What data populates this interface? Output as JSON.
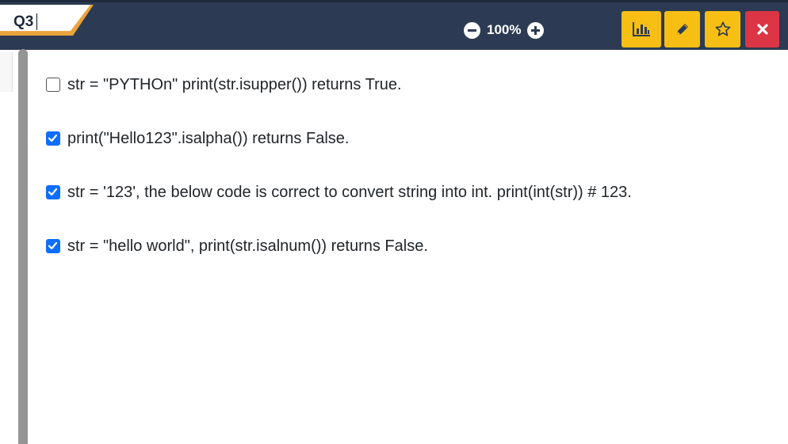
{
  "header": {
    "question_label": "Q3",
    "zoom_level": "100%"
  },
  "toolbar": {
    "report_icon": "bar-chart-icon",
    "edit_icon": "pencil-icon",
    "bookmark_icon": "star-icon",
    "close_icon": "close-icon",
    "accent_yellow": "#f7bf14",
    "accent_red": "#dc3545",
    "header_bg": "#2c3b53"
  },
  "options": [
    {
      "text": "str = \"PYTHOn\" print(str.isupper()) returns True.",
      "checked": false
    },
    {
      "text": "print(\"Hello123\".isalpha()) returns False.",
      "checked": true
    },
    {
      "text": "str = '123', the below code is correct to convert string into int. print(int(str)) # 123.",
      "checked": true
    },
    {
      "text": "str = \"hello world\", print(str.isalnum()) returns False.",
      "checked": true
    }
  ]
}
